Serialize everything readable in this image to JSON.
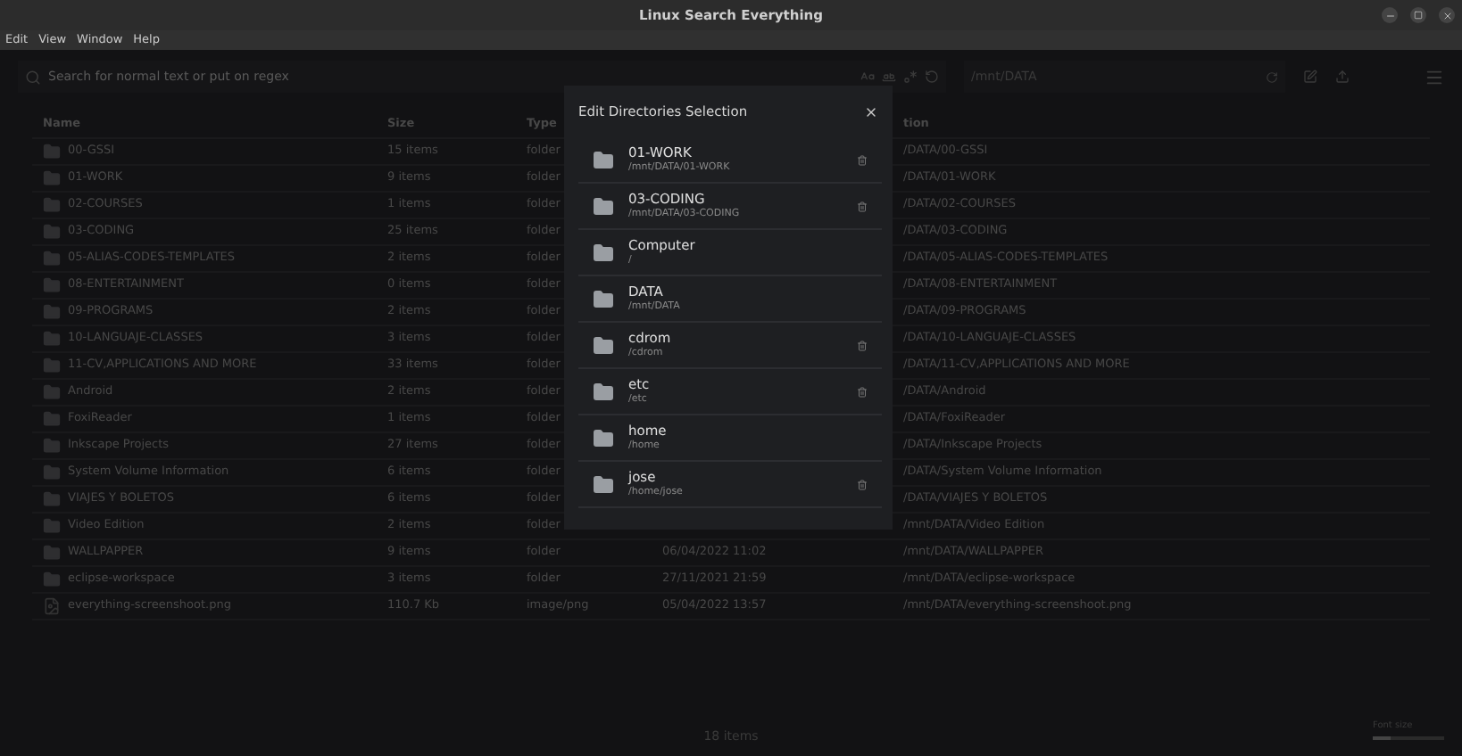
{
  "window": {
    "title": "Linux Search Everything"
  },
  "menu": [
    "Edit",
    "View",
    "Window",
    "Help"
  ],
  "search": {
    "placeholder": "Search for normal text or put on regex"
  },
  "path_field": {
    "value": "/mnt/DATA"
  },
  "table": {
    "columns": [
      "Name",
      "Size",
      "Type",
      "",
      "tion"
    ],
    "rows": [
      {
        "kind": "folder",
        "name": "00-GSSI",
        "size": "15 items",
        "type": "folder",
        "location": "/DATA/00-GSSI"
      },
      {
        "kind": "folder",
        "name": "01-WORK",
        "size": "9 items",
        "type": "folder",
        "location": "/DATA/01-WORK"
      },
      {
        "kind": "folder",
        "name": "02-COURSES",
        "size": "1 items",
        "type": "folder",
        "location": "/DATA/02-COURSES"
      },
      {
        "kind": "folder",
        "name": "03-CODING",
        "size": "25 items",
        "type": "folder",
        "location": "/DATA/03-CODING"
      },
      {
        "kind": "folder",
        "name": "05-ALIAS-CODES-TEMPLATES",
        "size": "2 items",
        "type": "folder",
        "location": "/DATA/05-ALIAS-CODES-TEMPLATES"
      },
      {
        "kind": "folder",
        "name": "08-ENTERTAINMENT",
        "size": "0 items",
        "type": "folder",
        "location": "/DATA/08-ENTERTAINMENT"
      },
      {
        "kind": "folder",
        "name": "09-PROGRAMS",
        "size": "2 items",
        "type": "folder",
        "location": "/DATA/09-PROGRAMS"
      },
      {
        "kind": "folder",
        "name": "10-LANGUAJE-CLASSES",
        "size": "3 items",
        "type": "folder",
        "location": "/DATA/10-LANGUAJE-CLASSES"
      },
      {
        "kind": "folder",
        "name": "11-CV,APPLICATIONS AND MORE",
        "size": "33 items",
        "type": "folder",
        "location": "/DATA/11-CV,APPLICATIONS AND MORE"
      },
      {
        "kind": "folder",
        "name": "Android",
        "size": "2 items",
        "type": "folder",
        "location": "/DATA/Android"
      },
      {
        "kind": "folder",
        "name": "FoxiReader",
        "size": "1 items",
        "type": "folder",
        "location": "/DATA/FoxiReader"
      },
      {
        "kind": "folder",
        "name": "Inkscape Projects",
        "size": "27 items",
        "type": "folder",
        "location": "/DATA/Inkscape Projects"
      },
      {
        "kind": "folder",
        "name": "System Volume Information",
        "size": "6 items",
        "type": "folder",
        "location": "/DATA/System Volume Information"
      },
      {
        "kind": "folder",
        "name": "VIAJES Y BOLETOS",
        "size": "6 items",
        "type": "folder",
        "location": "/DATA/VIAJES Y BOLETOS"
      },
      {
        "kind": "folder",
        "name": "Video Edition",
        "size": "2 items",
        "type": "folder",
        "location": "/mnt/DATA/Video Edition"
      },
      {
        "kind": "folder",
        "name": "WALLPAPPER",
        "size": "9 items",
        "type": "folder",
        "modified": "06/04/2022 11:02",
        "location": "/mnt/DATA/WALLPAPPER"
      },
      {
        "kind": "folder",
        "name": "eclipse-workspace",
        "size": "3 items",
        "type": "folder",
        "modified": "27/11/2021 21:59",
        "location": "/mnt/DATA/eclipse-workspace"
      },
      {
        "kind": "image",
        "name": "everything-screenshoot.png",
        "size": "110.7 Kb",
        "type": "image/png",
        "modified": "05/04/2022 13:57",
        "location": "/mnt/DATA/everything-screenshoot.png"
      }
    ]
  },
  "status": "18 items",
  "font_size": {
    "label": "Font size",
    "level": 0.25
  },
  "dialog": {
    "title": "Edit Directories Selection",
    "items": [
      {
        "name": "01-WORK",
        "path": "/mnt/DATA/01-WORK",
        "removable": true
      },
      {
        "name": "03-CODING",
        "path": "/mnt/DATA/03-CODING",
        "removable": true
      },
      {
        "name": "Computer",
        "path": "/",
        "removable": false
      },
      {
        "name": "DATA",
        "path": "/mnt/DATA",
        "removable": false
      },
      {
        "name": "cdrom",
        "path": "/cdrom",
        "removable": true
      },
      {
        "name": "etc",
        "path": "/etc",
        "removable": true
      },
      {
        "name": "home",
        "path": "/home",
        "removable": false
      },
      {
        "name": "jose",
        "path": "/home/jose",
        "removable": true
      }
    ]
  }
}
